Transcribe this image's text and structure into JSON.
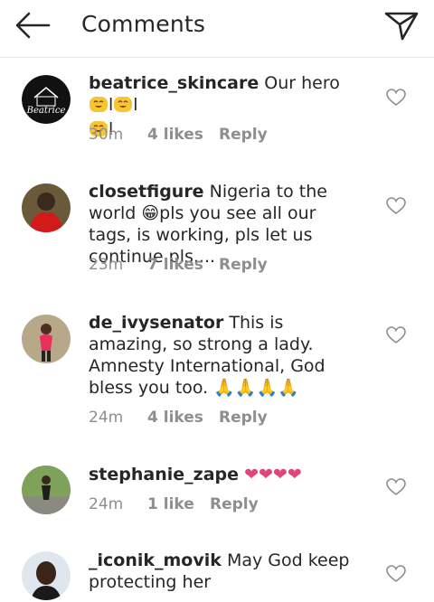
{
  "header": {
    "title": "Comments",
    "back_icon": "arrow-left-icon",
    "send_icon": "paper-plane-icon"
  },
  "comments": [
    {
      "username": "beatrice_skincare",
      "text": "Our hero",
      "emojis": [
        "😊",
        "😊",
        "😊"
      ],
      "separators": "l",
      "time": "30m",
      "likes": "4 likes",
      "reply": "Reply",
      "avatar_text": "Beatrice"
    },
    {
      "username": "closetfigure",
      "text": "Nigeria to the world 😁pls you see all our tags, is working, pls let us continue pls....",
      "time": "23m",
      "likes": "7 likes",
      "reply": "Reply"
    },
    {
      "username": "de_ivysenator",
      "text": "This is amazing, so strong a lady. Amnesty International, God bless you too. 🙏🙏🙏🙏",
      "time": "24m",
      "likes": "4 likes",
      "reply": "Reply"
    },
    {
      "username": "stephanie_zape",
      "text": "❤❤❤❤",
      "time": "24m",
      "likes": "1 like",
      "reply": "Reply"
    },
    {
      "username": "_iconik_movik",
      "text": "May God keep protecting her",
      "time": "",
      "likes": "",
      "reply": ""
    }
  ],
  "colors": {
    "text": "#262626",
    "muted": "#8e8e8e",
    "divider": "#e6e6e6",
    "heart_emoji": "#e0457b",
    "emoji_yellow": "#f7c531"
  }
}
